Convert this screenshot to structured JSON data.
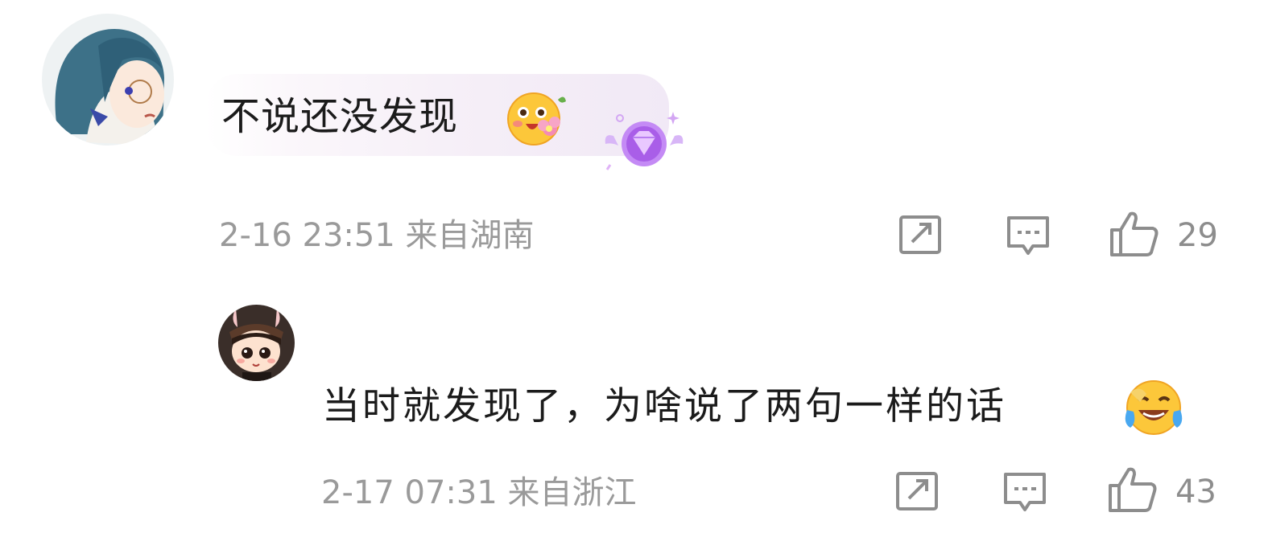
{
  "comments": [
    {
      "text": "不说还没发现",
      "emoji": "blushing-flower-emoji",
      "badge": "purple-diamond-badge",
      "meta": "2-16 23:51 来自湖南",
      "likes": "29",
      "avatar": "anime-girl-blue-hair-avatar"
    },
    {
      "text": "当时就发现了，为啥说了两句一样的话",
      "emoji": "laughing-tears-emoji",
      "meta": "2-17 07:31 来自浙江",
      "likes": "43",
      "avatar": "chibi-bunny-ears-avatar"
    }
  ],
  "colors": {
    "meta_text": "#9a9a9a",
    "icon_stroke": "#8d8d8d",
    "badge_purple": "#b76ff0"
  }
}
